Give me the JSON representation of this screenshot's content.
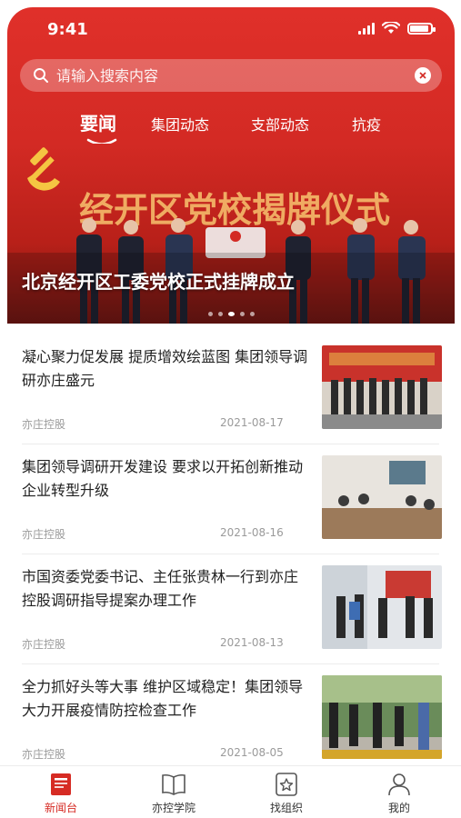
{
  "status_bar": {
    "time": "9:41"
  },
  "search": {
    "placeholder": "请输入搜索内容"
  },
  "tabs": [
    {
      "label": "要闻",
      "active": true
    },
    {
      "label": "集团动态",
      "active": false
    },
    {
      "label": "支部动态",
      "active": false
    },
    {
      "label": "抗疫",
      "active": false
    }
  ],
  "banner": {
    "sign_text": "经开区党校揭牌仪式",
    "caption": "北京经开区工委党校正式挂牌成立",
    "dot_count": 5,
    "active_dot": 3
  },
  "news": [
    {
      "title": "凝心聚力促发展 提质增效绘蓝图 集团领导调研亦庄盛元",
      "source": "亦庄控股",
      "date": "2021-08-17"
    },
    {
      "title": "集团领导调研开发建设 要求以开拓创新推动企业转型升级",
      "source": "亦庄控股",
      "date": "2021-08-16"
    },
    {
      "title": "市国资委党委书记、主任张贵林一行到亦庄控股调研指导提案办理工作",
      "source": "亦庄控股",
      "date": "2021-08-13"
    },
    {
      "title": "全力抓好头等大事 维护区域稳定！集团领导大力开展疫情防控检查工作",
      "source": "亦庄控股",
      "date": "2021-08-05"
    }
  ],
  "bottom_nav": [
    {
      "label": "新闻台",
      "icon": "news-icon",
      "active": true
    },
    {
      "label": "亦控学院",
      "icon": "book-icon",
      "active": false
    },
    {
      "label": "找组织",
      "icon": "star-icon",
      "active": false
    },
    {
      "label": "我的",
      "icon": "user-icon",
      "active": false
    }
  ],
  "colors": {
    "brand_red": "#d62b24",
    "muted": "#9a9a9a"
  }
}
